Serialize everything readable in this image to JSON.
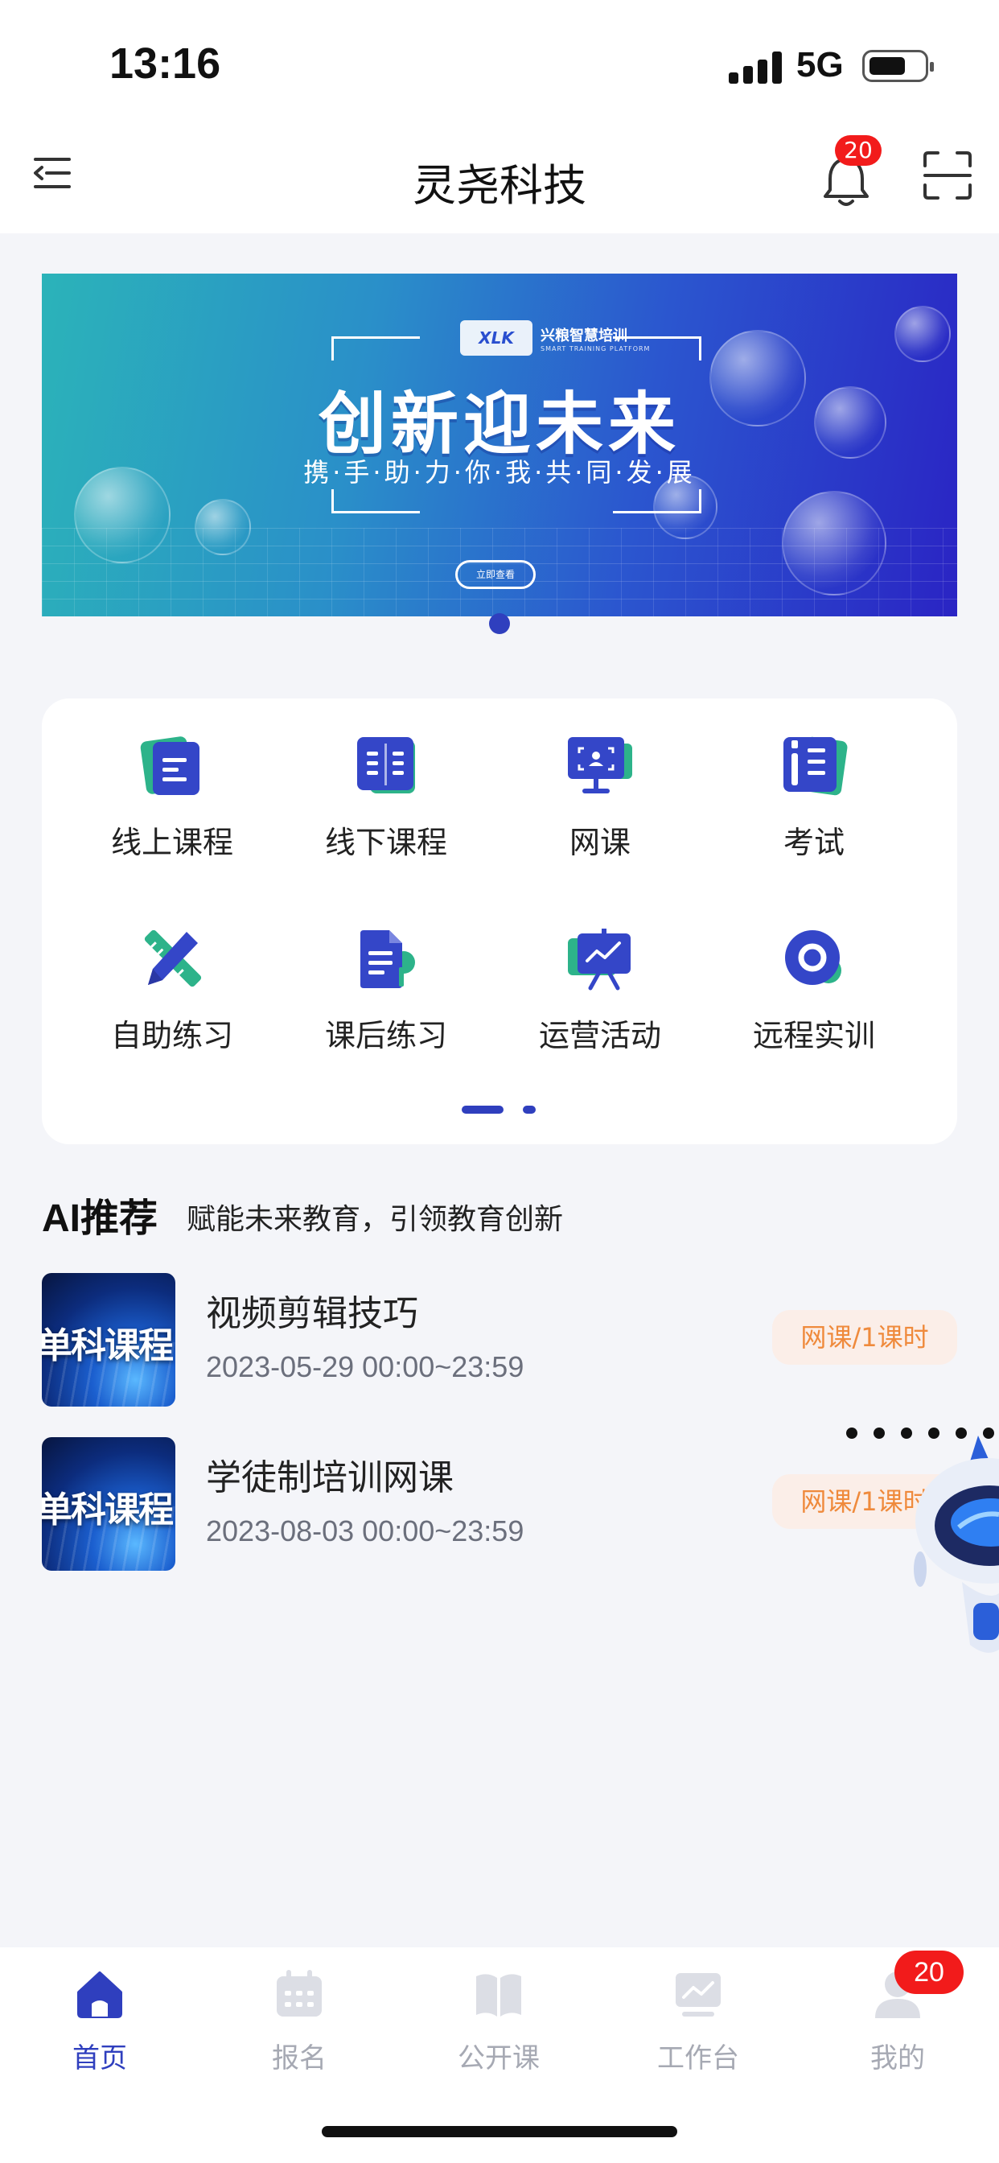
{
  "status_bar": {
    "time": "13:16",
    "network": "5G"
  },
  "header": {
    "title": "灵尧科技",
    "notification_count": "20"
  },
  "banner": {
    "logo_text": "兴粮智慧培训",
    "logo_sub": "SMART TRAINING PLATFORM",
    "logo_mark": "XLK",
    "headline": "创新迎未来",
    "subline": "携·手·助·力·你·我·共·同·发·展",
    "button": "立即查看"
  },
  "grid": {
    "items": [
      {
        "label": "线上课程",
        "icon": "online-course-icon"
      },
      {
        "label": "线下课程",
        "icon": "offline-course-icon"
      },
      {
        "label": "网课",
        "icon": "web-course-icon"
      },
      {
        "label": "考试",
        "icon": "exam-icon"
      },
      {
        "label": "自助练习",
        "icon": "self-practice-icon"
      },
      {
        "label": "课后练习",
        "icon": "after-class-practice-icon"
      },
      {
        "label": "运营活动",
        "icon": "operation-activity-icon"
      },
      {
        "label": "远程实训",
        "icon": "remote-training-icon"
      }
    ]
  },
  "ai_section": {
    "title": "AI推荐",
    "subtitle": "赋能未来教育，引领教育创新",
    "courses": [
      {
        "thumb_text": "单科课程",
        "name": "视频剪辑技巧",
        "date": "2023-05-29 00:00~23:59",
        "tag": "网课/1课时"
      },
      {
        "thumb_text": "单科课程",
        "name": "学徒制培训网课",
        "date": "2023-08-03 00:00~23:59",
        "tag": "网课/1课时"
      }
    ]
  },
  "bottom_nav": {
    "items": [
      {
        "label": "首页",
        "icon": "home-icon",
        "active": true
      },
      {
        "label": "报名",
        "icon": "calendar-icon",
        "active": false
      },
      {
        "label": "公开课",
        "icon": "book-icon",
        "active": false
      },
      {
        "label": "工作台",
        "icon": "workbench-icon",
        "active": false
      },
      {
        "label": "我的",
        "icon": "profile-icon",
        "active": false
      }
    ],
    "badge": "20"
  },
  "colors": {
    "primary": "#2f3fbe",
    "accent_green": "#2db38a",
    "badge_red": "#f21b1b",
    "tag_orange": "#ef8a3c"
  }
}
